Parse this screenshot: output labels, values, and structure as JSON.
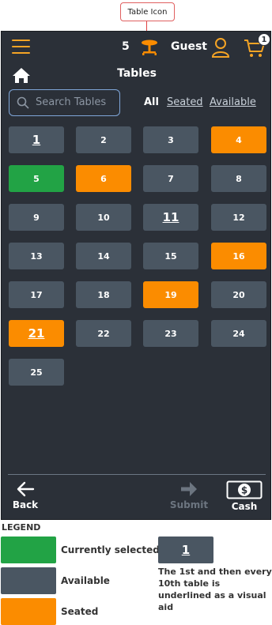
{
  "callout": {
    "label": "Table Icon"
  },
  "header": {
    "guest_count": "5",
    "guest_label": "Guest",
    "cart_count": "1",
    "title": "Tables"
  },
  "search": {
    "placeholder": "Search Tables"
  },
  "filters": {
    "all": "All",
    "seated": "Seated",
    "available": "Available"
  },
  "tables": [
    {
      "label": "1",
      "status": "available",
      "marker": true
    },
    {
      "label": "2",
      "status": "available",
      "marker": false
    },
    {
      "label": "3",
      "status": "available",
      "marker": false
    },
    {
      "label": "4",
      "status": "seated",
      "marker": false
    },
    {
      "label": "5",
      "status": "selected",
      "marker": false
    },
    {
      "label": "6",
      "status": "seated",
      "marker": false
    },
    {
      "label": "7",
      "status": "available",
      "marker": false
    },
    {
      "label": "8",
      "status": "available",
      "marker": false
    },
    {
      "label": "9",
      "status": "available",
      "marker": false
    },
    {
      "label": "10",
      "status": "available",
      "marker": false
    },
    {
      "label": "11",
      "status": "available",
      "marker": true
    },
    {
      "label": "12",
      "status": "available",
      "marker": false
    },
    {
      "label": "13",
      "status": "available",
      "marker": false
    },
    {
      "label": "14",
      "status": "available",
      "marker": false
    },
    {
      "label": "15",
      "status": "available",
      "marker": false
    },
    {
      "label": "16",
      "status": "seated",
      "marker": false
    },
    {
      "label": "17",
      "status": "available",
      "marker": false
    },
    {
      "label": "18",
      "status": "available",
      "marker": false
    },
    {
      "label": "19",
      "status": "seated",
      "marker": false
    },
    {
      "label": "20",
      "status": "available",
      "marker": false
    },
    {
      "label": "21",
      "status": "seated",
      "marker": true
    },
    {
      "label": "22",
      "status": "available",
      "marker": false
    },
    {
      "label": "23",
      "status": "available",
      "marker": false
    },
    {
      "label": "24",
      "status": "available",
      "marker": false
    },
    {
      "label": "25",
      "status": "available",
      "marker": false
    }
  ],
  "footer": {
    "back": "Back",
    "submit": "Submit",
    "cash": "Cash"
  },
  "legend": {
    "title": "LEGEND",
    "selected": "Currently selected",
    "available": "Available",
    "seated": "Seated",
    "marker_example": "1",
    "marker_note": "The 1st and then every 10th table is underlined as a visual aid"
  },
  "colors": {
    "accent": "#f5a425",
    "background": "#2b3038",
    "tile": "#4a5662",
    "seated": "#fb8c00",
    "selected": "#22a345"
  },
  "icons": [
    "menu-icon",
    "table-icon",
    "user-icon",
    "cart-icon",
    "home-icon",
    "search-icon",
    "back-arrow-icon",
    "submit-arrow-icon",
    "cash-icon"
  ]
}
